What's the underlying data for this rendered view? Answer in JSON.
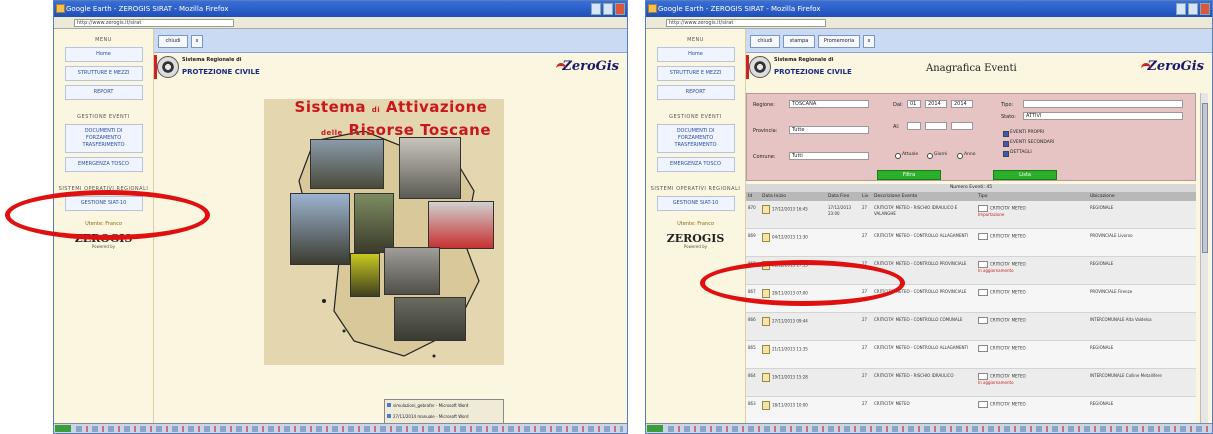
{
  "left": {
    "titlebar": "Google Earth - ZEROGIS SIRAT - Mozilla Firefox",
    "url": "http://www.zerogis.it/sirat",
    "tabs": [
      "chiudi",
      "x"
    ],
    "sidebar": {
      "menu_heading": "MENU",
      "items": [
        "Home",
        "STRUTTURE E MEZZI",
        "REPORT"
      ],
      "section_heading": "GESTIONE EVENTI",
      "section_items": [
        "DOCUMENTI DI FORZAMENTO TRASFERIMENTO",
        "EMERGENZA TOSCO"
      ],
      "extra_heading": "SISTEMI OPERATIVI REGIONALI",
      "extra_items": [
        "GESTIONE SIAT-10"
      ],
      "user_label": "Utente: Franco",
      "logo": "ZEROGIS",
      "logo_sub": "Powered by"
    },
    "header": {
      "sub": "Sistema Regionale di",
      "main": "PROTEZIONE CIVILE",
      "brand": "ZeroGis"
    },
    "poster": {
      "line1_a": "Sistema",
      "line1_small": "di",
      "line1_b": "Attivazione",
      "line2_small": "delle",
      "line2_b": "Risorse Toscane"
    },
    "popup": [
      "simulazioni_gebrafer - Microsoft Word",
      "27/11/2014 manuale - Microsoft Word"
    ]
  },
  "right": {
    "titlebar": "Google Earth - ZEROGIS SIRAT - Mozilla Firefox",
    "url": "http://www.zerogis.it/sirat",
    "tabs": [
      "chiudi",
      "stampa",
      "Promemoria",
      "x"
    ],
    "sidebar": {
      "menu_heading": "MENU",
      "items": [
        "Home",
        "STRUTTURE E MEZZI",
        "REPORT"
      ],
      "section_heading": "GESTIONE EVENTI",
      "section_items": [
        "DOCUMENTI DI FORZAMENTO TRASFERIMENTO",
        "EMERGENZA TOSCO"
      ],
      "extra_heading": "SISTEMI OPERATIVI REGIONALI",
      "extra_items": [
        "GESTIONE SIAT-10"
      ],
      "user_label": "Utente: Franco",
      "logo": "ZEROGIS",
      "logo_sub": "Powered by"
    },
    "header": {
      "sub": "Sistema Regionale di",
      "main": "PROTEZIONE CIVILE",
      "page_title": "Anagrafica Eventi",
      "brand": "ZeroGis"
    },
    "filter": {
      "labels": {
        "regione": "Regione:",
        "provincia": "Provincia:",
        "comune": "Comune:",
        "dal": "Dal:",
        "al": "Al:",
        "tipo": "Tipo:",
        "stato": "Stato:"
      },
      "values": {
        "regione": "TOSCANA",
        "provincia": "Tutte",
        "comune": "Tutti",
        "tipo": "",
        "stato": "ATTIVI"
      },
      "dates": [
        "01",
        "2014",
        "2014"
      ],
      "radios": [
        "Attuale",
        "Giorni",
        "Anno"
      ],
      "checks": [
        "EVENTI PROPRI",
        "EVENTI SECONDARI",
        "DETTAGLI"
      ],
      "buttons": [
        "Filtra",
        "Lista"
      ]
    },
    "table": {
      "caption": "Numero Eventi: 45",
      "headers": [
        "Id",
        "Data Inizio",
        "Data Fine",
        "Liv",
        "Descrizione Evento",
        "Tipo",
        "Ubicazione"
      ],
      "rows": [
        {
          "id": "870",
          "inizio": "17/12/2013 16:45",
          "fine": "17/12/2013 23:00",
          "liv": "27",
          "desc": "CRITICITA' METEO - RISCHIO IDRAULICO E VALANGHE",
          "tipo": "CRITICITA' METEO",
          "tipo_note": "Importazione",
          "ubic": "REGIONALE"
        },
        {
          "id": "869",
          "inizio": "04/12/2013 11:30",
          "fine": "",
          "liv": "27",
          "desc": "CRITICITA' METEO - CONTROLLO ALLAGAMENTI",
          "tipo": "CRITICITA' METEO",
          "tipo_note": "",
          "ubic": "PROVINCIALE Livorno"
        },
        {
          "id": "868",
          "inizio": "01/12/2013 17:35",
          "fine": "",
          "liv": "27",
          "desc": "CRITICITA' METEO - CONTROLLO PROVINCIALE",
          "tipo": "CRITICITA' METEO",
          "tipo_note": "In aggiornamento",
          "ubic": "REGIONALE"
        },
        {
          "id": "867",
          "inizio": "28/11/2013 07:00",
          "fine": "",
          "liv": "27",
          "desc": "CRITICITA' METEO - CONTROLLO PROVINCIALE",
          "tipo": "CRITICITA' METEO",
          "tipo_note": "",
          "ubic": "PROVINCIALE Firenze"
        },
        {
          "id": "866",
          "inizio": "27/11/2013 09:44",
          "fine": "",
          "liv": "27",
          "desc": "CRITICITA' METEO - CONTROLLO COMUNALE",
          "tipo": "CRITICITA' METEO",
          "tipo_note": "",
          "ubic": "INTERCOMUNALE Alta Valdelsa"
        },
        {
          "id": "865",
          "inizio": "21/11/2013 11:35",
          "fine": "",
          "liv": "27",
          "desc": "CRITICITA' METEO - CONTROLLO ALLAGAMENTI",
          "tipo": "CRITICITA' METEO",
          "tipo_note": "",
          "ubic": "REGIONALE"
        },
        {
          "id": "864",
          "inizio": "19/11/2013 15:28",
          "fine": "",
          "liv": "27",
          "desc": "CRITICITA' METEO - RISCHIO IDRAULICO",
          "tipo": "CRITICITA' METEO",
          "tipo_note": "In aggiornamento",
          "ubic": "INTERCOMUNALE Colline Metallifere"
        },
        {
          "id": "863",
          "inizio": "18/11/2013 10:00",
          "fine": "",
          "liv": "27",
          "desc": "CRITICITA' METEO",
          "tipo": "CRITICITA' METEO",
          "tipo_note": "",
          "ubic": "REGIONALE"
        }
      ]
    }
  },
  "colors": {
    "annotation": "#e01010",
    "title_red": "#c8171e",
    "filter_bg": "#e6c4c4",
    "button_green": "#2bb02b"
  }
}
